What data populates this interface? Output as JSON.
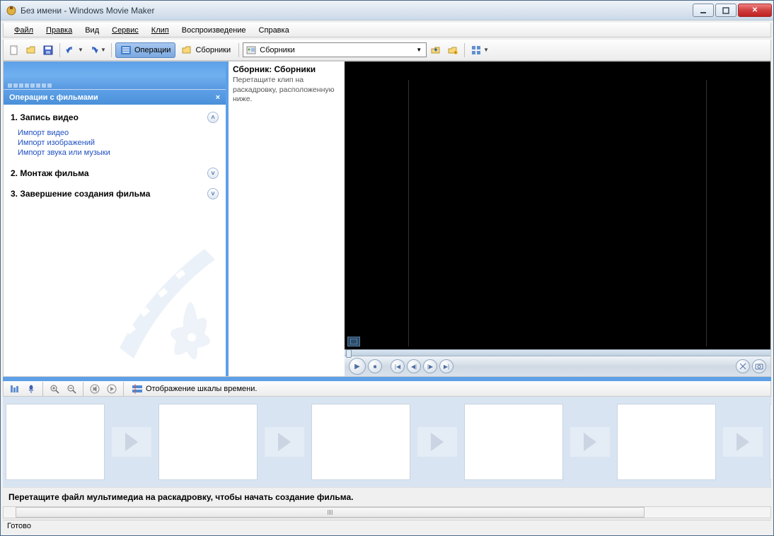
{
  "titlebar": {
    "text": "Без имени - Windows Movie Maker"
  },
  "menu": {
    "file": "Файл",
    "edit": "Правка",
    "view": "Вид",
    "service": "Сервис",
    "clip": "Клип",
    "play": "Воспроизведение",
    "help": "Справка"
  },
  "toolbar": {
    "operations": "Операции",
    "collections": "Сборники",
    "combo_value": "Сборники"
  },
  "tasks": {
    "header": "Операции с фильмами",
    "s1_title": "1. Запись видео",
    "s1_links": {
      "l1": "Импорт видео",
      "l2": "Импорт изображений",
      "l3": "Импорт звука или музыки"
    },
    "s2_title": "2. Монтаж фильма",
    "s3_title": "3. Завершение создания фильма"
  },
  "collection": {
    "title": "Сборник: Сборники",
    "hint": "Перетащите клип на раскадровку, расположенную ниже."
  },
  "timeline": {
    "toggle_label": "Отображение шкалы времени.",
    "hint": "Перетащите файл мультимедиа на раскадровку, чтобы начать создание фильма."
  },
  "status": {
    "text": "Готово"
  }
}
